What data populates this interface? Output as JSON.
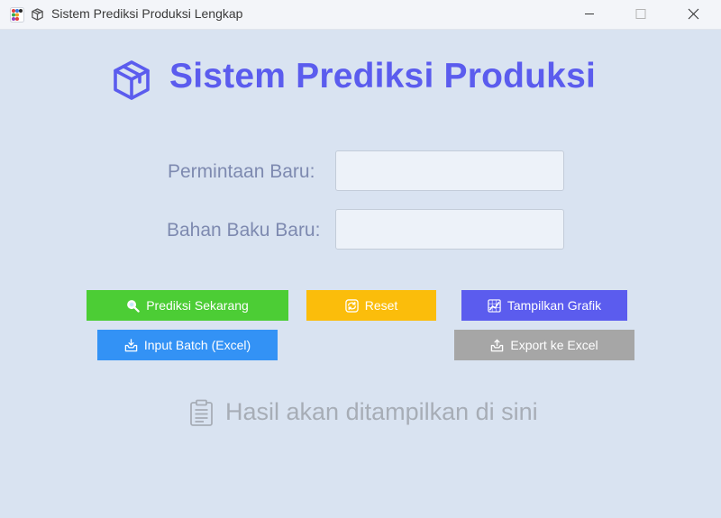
{
  "window": {
    "title": "Sistem Prediksi Produksi Lengkap",
    "controls": [
      "minimize-icon",
      "maximize-icon",
      "close-icon"
    ]
  },
  "header": {
    "title": "Sistem Prediksi Produksi",
    "icon": "box-icon",
    "color": "#5b5cee"
  },
  "form": {
    "permintaan": {
      "label": "Permintaan Baru:",
      "value": "",
      "placeholder": ""
    },
    "bahan_baku": {
      "label": "Bahan Baku Baru:",
      "value": "",
      "placeholder": ""
    }
  },
  "buttons": {
    "prediksi": {
      "label": "Prediksi Sekarang",
      "icon": "magnifier-icon",
      "color": "#4ccd35"
    },
    "reset": {
      "label": "Reset",
      "icon": "refresh-icon",
      "color": "#fbbd0b"
    },
    "grafik": {
      "label": "Tampilkan Grafik",
      "icon": "chart-icon",
      "color": "#5b5cee"
    },
    "batch": {
      "label": "Input Batch (Excel)",
      "icon": "inbox-tray-icon",
      "color": "#3392f5"
    },
    "export": {
      "label": "Export ke Excel",
      "icon": "outbox-tray-icon",
      "color": "#a6a6a6"
    }
  },
  "result": {
    "text": "Hasil akan ditampilkan di sini",
    "icon": "clipboard-icon"
  }
}
